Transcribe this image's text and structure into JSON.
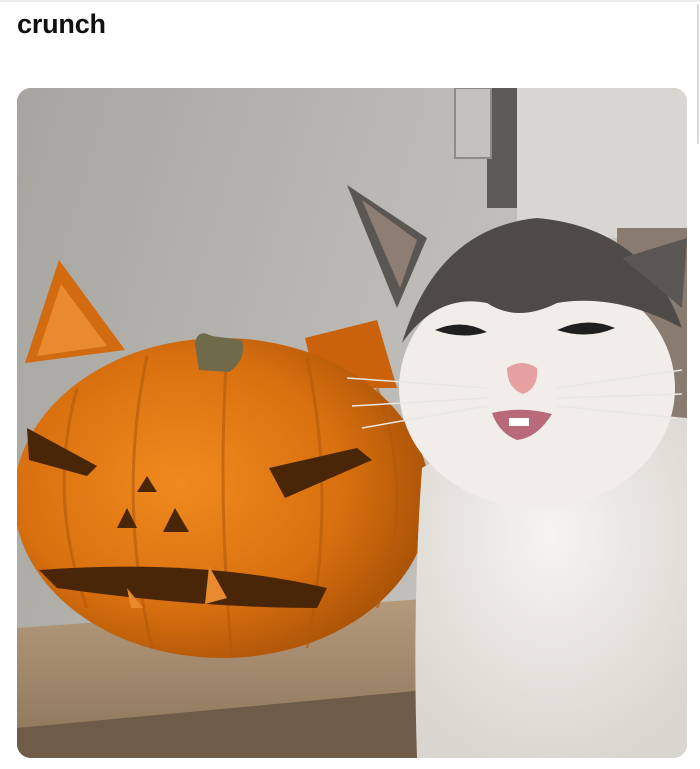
{
  "post": {
    "title": "crunch",
    "media_icon": "photo-icon"
  }
}
